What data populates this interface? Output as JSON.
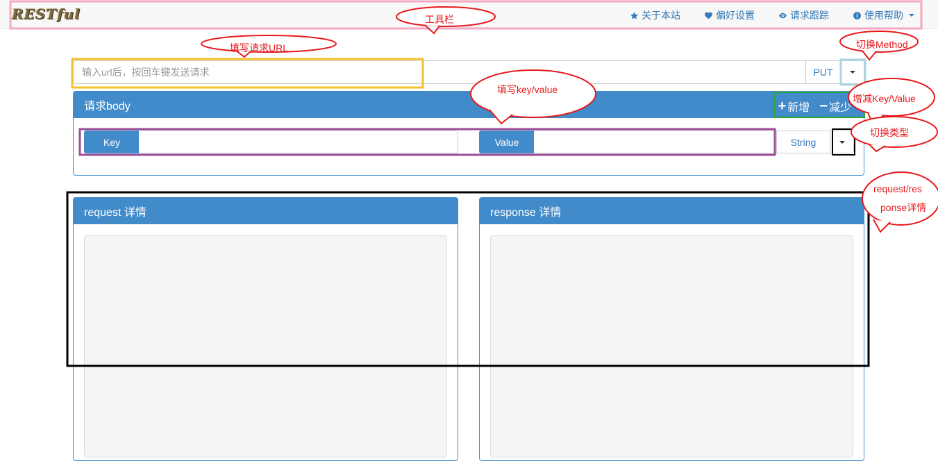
{
  "navbar": {
    "brand": "RESTful",
    "items": [
      {
        "icon": "star-icon",
        "label": "关于本站"
      },
      {
        "icon": "heart-icon",
        "label": "偏好设置"
      },
      {
        "icon": "eye-icon",
        "label": "请求跟踪"
      },
      {
        "icon": "info-icon",
        "label": "使用帮助"
      }
    ]
  },
  "url_bar": {
    "placeholder": "输入url后，按回车键发送请求",
    "method": "PUT"
  },
  "body_panel": {
    "title": "请求body",
    "add_label": "新增",
    "remove_label": "减少",
    "key_label": "Key",
    "value_label": "Value",
    "type": "String"
  },
  "request_panel": {
    "title": "request 详情"
  },
  "response_panel": {
    "title": "response 详情"
  },
  "annotations": {
    "toolbar": "工具栏",
    "fill_url": "填写请求URL",
    "switch_method": "切换Method",
    "fill_kv": "填写key/value",
    "add_remove_kv": "增减Key/Value",
    "switch_type": "切换类型",
    "req_res_line1": "request/res",
    "req_res_line2": "ponse详情"
  },
  "colors": {
    "primary": "#428bca",
    "link": "#337ab7",
    "annotation_red": "#e8191c"
  }
}
